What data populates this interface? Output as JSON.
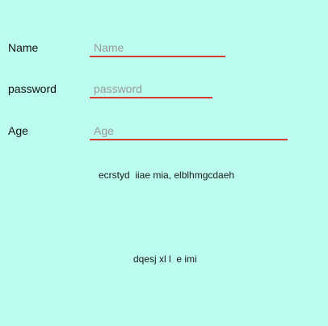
{
  "form": {
    "name": {
      "label": "Name",
      "placeholder": "Name",
      "value": ""
    },
    "password": {
      "label": "password",
      "placeholder": "password",
      "value": ""
    },
    "age": {
      "label": "Age",
      "placeholder": "Age",
      "value": ""
    }
  },
  "texts": {
    "line1": "ecrstyd  iiae mia, elblhmgcdaeh",
    "line2": "dqesj xl l  e imi"
  },
  "colors": {
    "background": "#bbfcee",
    "underline": "#d43a2f",
    "placeholder": "#9a9a9a"
  }
}
